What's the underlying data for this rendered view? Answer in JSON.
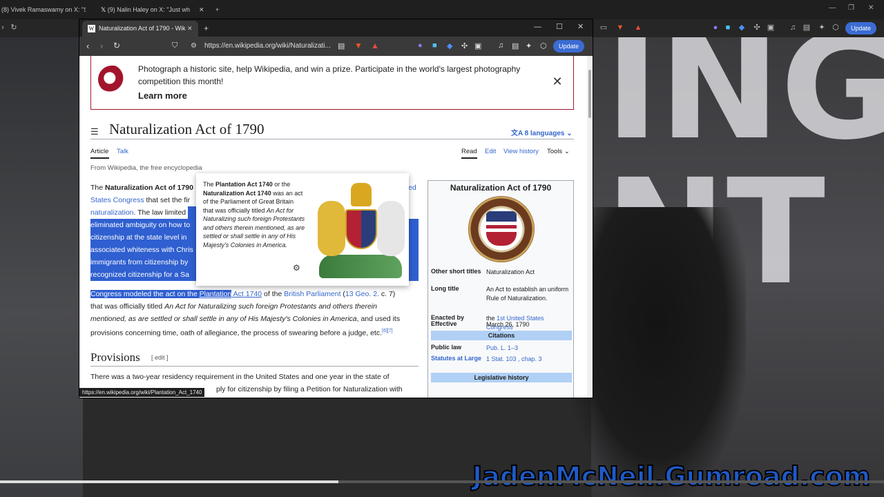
{
  "outer_tabs": [
    {
      "label": "(8) Vivek Ramaswamy on X: \"Sta"
    },
    {
      "label": "(9) Nalin Haley on X: \"Just wh"
    }
  ],
  "inner_tab": {
    "label": "Naturalization Act of 1790 - Wik"
  },
  "url": "https://en.wikipedia.org/wiki/Naturalizati...",
  "update_label": "Update",
  "banner": {
    "text": "Photograph a historic site, help Wikipedia, and win a prize. Participate in the world's largest photography competition this month!",
    "learn_more": "Learn more"
  },
  "article": {
    "title": "Naturalization Act of 1790",
    "languages": "8 languages",
    "tabs": {
      "article": "Article",
      "talk": "Talk",
      "read": "Read",
      "edit": "Edit",
      "history": "View history",
      "tools": "Tools"
    },
    "from": "From Wikipedia, the free encyclopedia",
    "p1": {
      "l1a": "The ",
      "l1b": "Naturalization Act of 1790",
      "l1c": "ed",
      "l2": "States Congress",
      "l2b": " that set the fir",
      "l3a": "naturalization",
      "l3b": ". The law limited ",
      "l4": "eliminated ambiguity on how to",
      "l5": "citizenship at the state level in ",
      "l6": "associated whiteness with Chris",
      "l7": "immigrants from citizenship by",
      "l8": "recognized citizenship for a Sa"
    },
    "p2": {
      "a": "Congress modeled the act on the ",
      "b": "Plantation",
      "c": " Act 1740",
      "d": " of the ",
      "e": "British Parliament",
      "f": " (",
      "g": "13 Geo. 2.",
      "h": " c. 7)",
      "i": "that was officially titled ",
      "j": "An Act for Naturalizing such foreign Protestants and others therein",
      "k": "mentioned, as are settled or shall settle in any of His Majesty's Colonies in America",
      "l": ", and used its",
      "m": "provisions concerning time, oath of allegiance, the process of swearing before a judge, etc.",
      "refs": "[6][7]"
    },
    "provisions": "Provisions",
    "provisions_edit": "[ edit ]",
    "prov_l1": "There was a two-year residency requirement in the United States and one year in the state of",
    "prov_l2": "ply for citizenship by filing a Petition for Naturalization with \"any"
  },
  "infobox": {
    "title": "Naturalization Act of 1790",
    "rows": [
      {
        "k": "Other short titles",
        "v": "Naturalization Act"
      },
      {
        "k": "Long title",
        "v": "An Act to establish an uniform Rule of Naturalization."
      },
      {
        "k": "Enacted by",
        "v_pre": "the ",
        "v": "1st United States Congress"
      },
      {
        "k": "Effective",
        "v": "March 26, 1790"
      }
    ],
    "citations": "Citations",
    "public_law_k": "Public law",
    "public_law_v": "Pub. L. 1–3",
    "statutes_k": "Statutes at Large",
    "statutes_v": "1 Stat. 103 , chap. 3",
    "leg_history": "Legislative history"
  },
  "popup": {
    "t1": "The ",
    "t2": "Plantation Act 1740",
    "t3": " or the ",
    "t4": "Naturalization Act 1740",
    "t5": " was an act of the Parliament of Great Britain that was officially titled ",
    "t6": "An Act for Naturalizing such foreign Protestants and others therein mentioned, as are settled or shall settle in any of His Majesty's Colonies in America."
  },
  "status_url": "https://en.wikipedia.org/wiki/Plantation_Act_1740",
  "watermark": "JadenMcNeil.Gumroad.com"
}
